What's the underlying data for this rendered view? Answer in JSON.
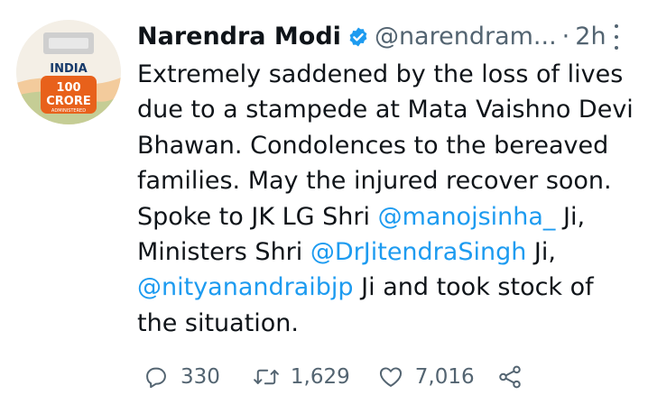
{
  "tweet": {
    "author_name": "Narendra Modi",
    "handle": "@narendram...",
    "separator": "·",
    "time": "2h",
    "avatar": {
      "badge_lines": [
        "INDIA",
        "100",
        "CRORE",
        "ADMINISTERED"
      ]
    },
    "body_lines": [
      [
        {
          "text": "Extremely saddened by the loss of lives"
        }
      ],
      [
        {
          "text": "due to a stampede at Mata Vaishno Devi"
        }
      ],
      [
        {
          "text": "Bhawan. Condolences to the bereaved"
        }
      ],
      [
        {
          "text": "families. May the injured recover soon."
        }
      ],
      [
        {
          "text": "Spoke to JK LG Shri "
        },
        {
          "text": "@manojsinha_",
          "mention": true
        },
        {
          "text": " Ji,"
        }
      ],
      [
        {
          "text": "Ministers Shri "
        },
        {
          "text": "@DrJitendraSingh",
          "mention": true
        },
        {
          "text": " Ji,"
        }
      ],
      [
        {
          "text": "@nityanandraibjp",
          "mention": true
        },
        {
          "text": " Ji and took stock of"
        }
      ],
      [
        {
          "text": "the situation."
        }
      ]
    ],
    "actions": {
      "replies": "330",
      "retweets": "1,629",
      "likes": "7,016"
    }
  },
  "colors": {
    "text": "#0f1419",
    "secondary": "#536471",
    "link": "#1d9bf0",
    "verified": "#1d9bf0"
  }
}
